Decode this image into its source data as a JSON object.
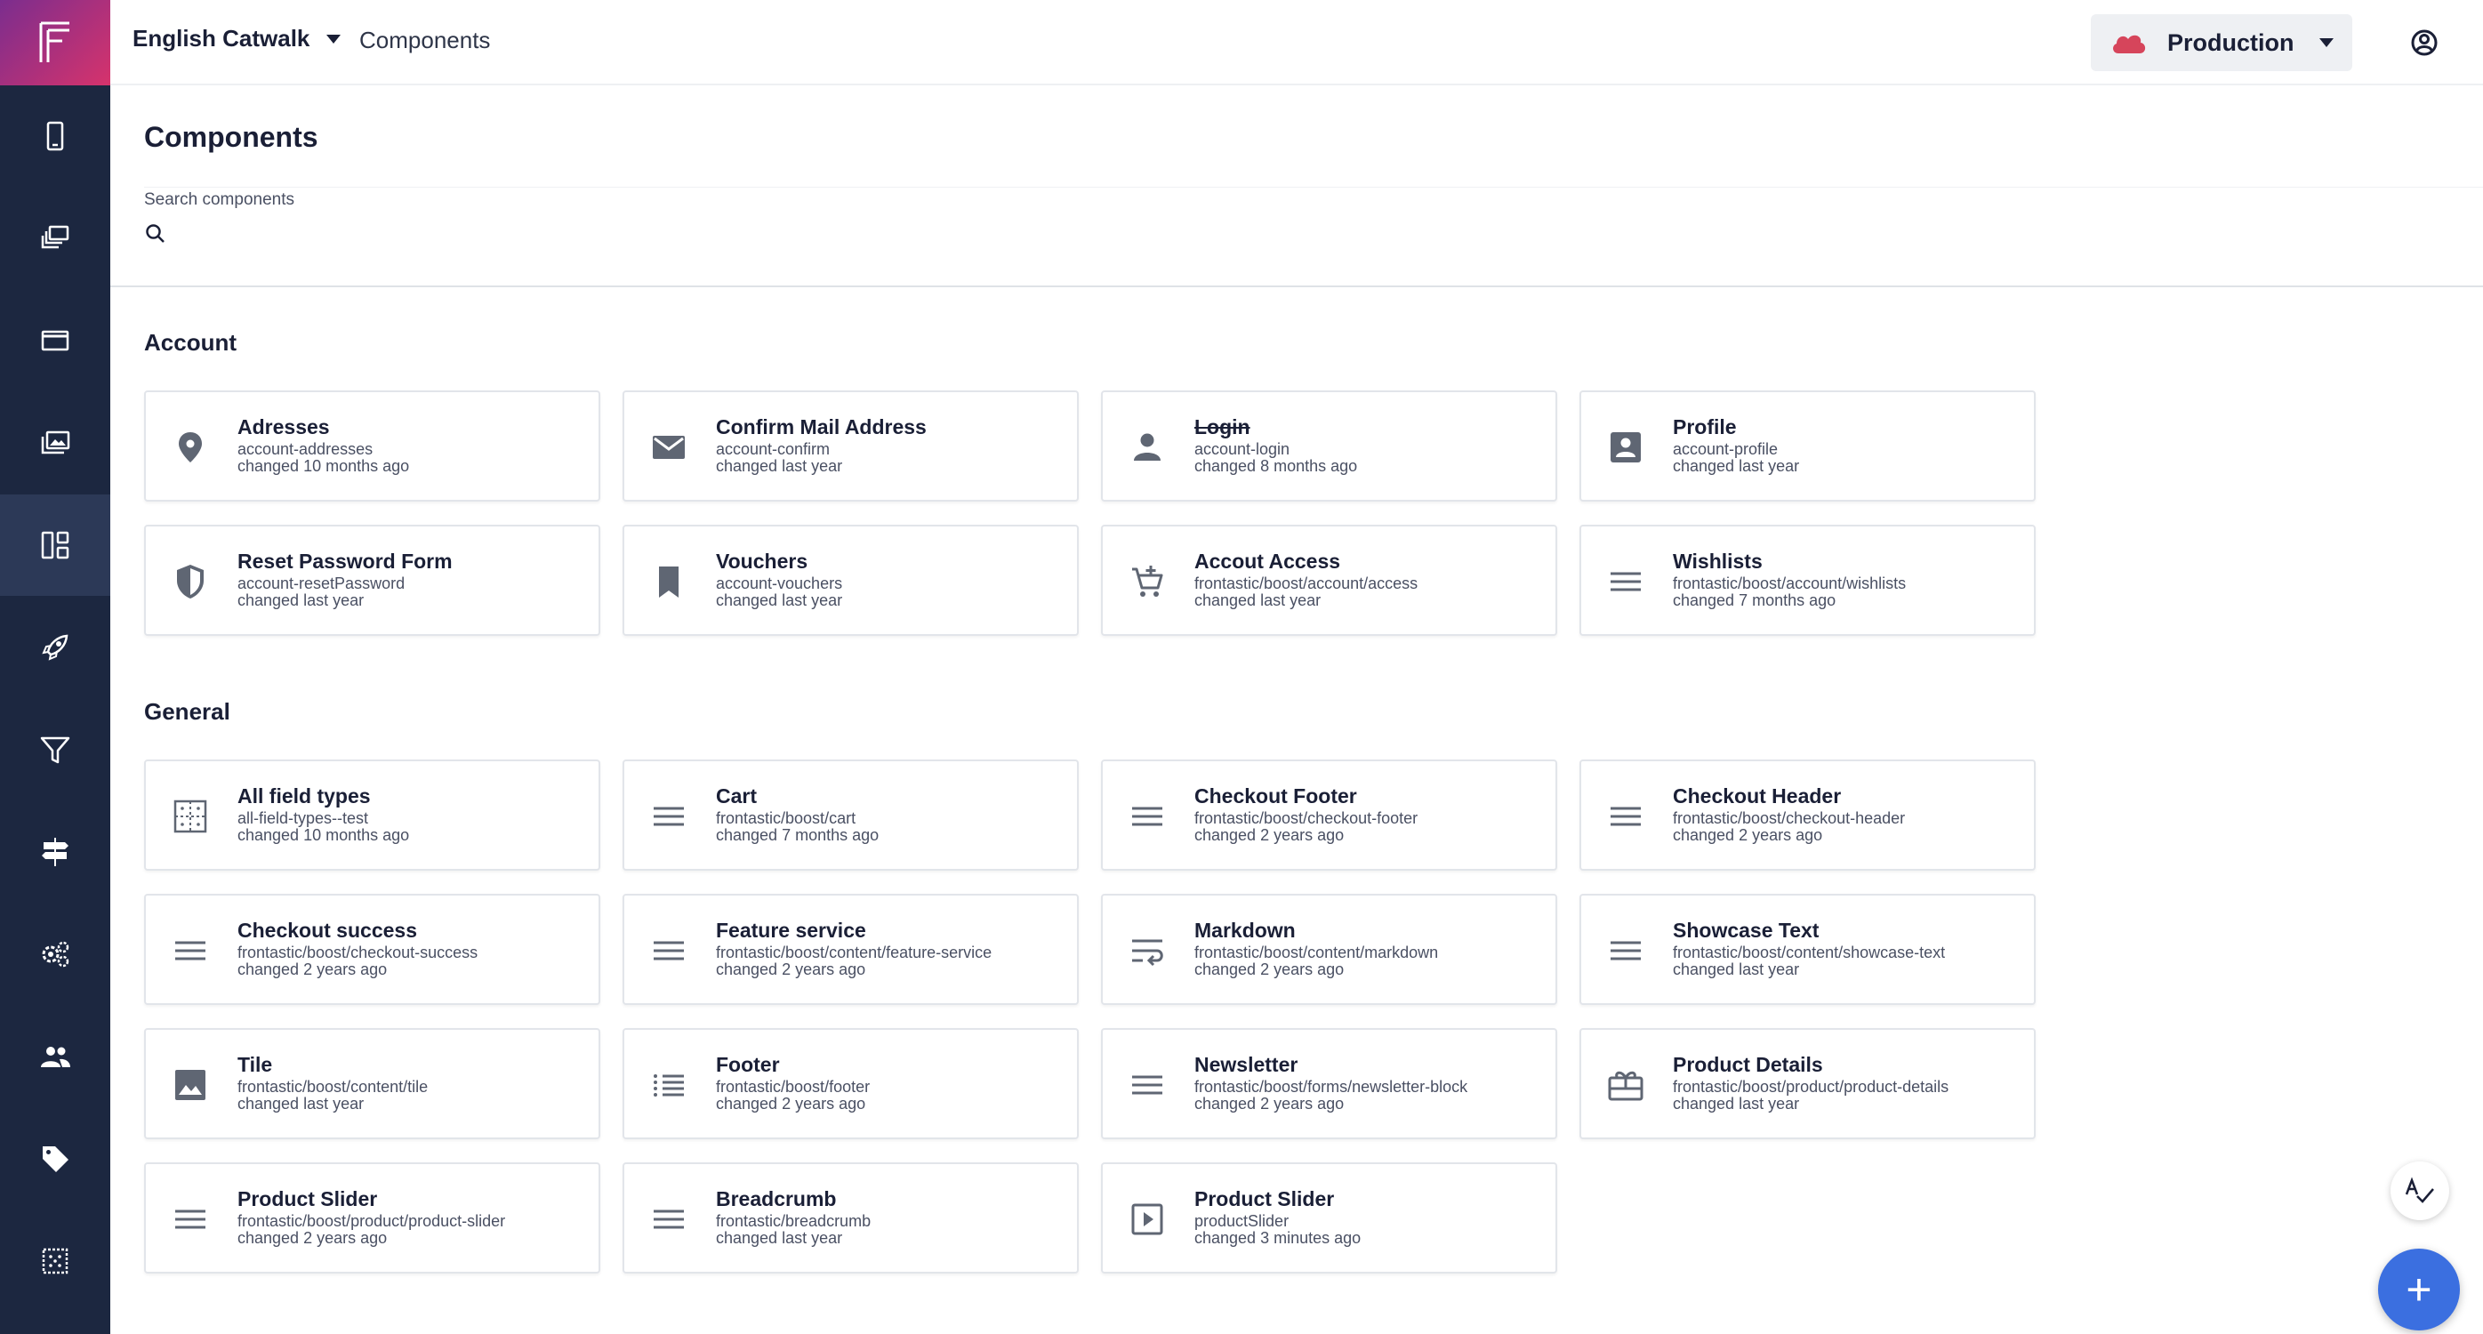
{
  "header": {
    "project_name": "English Catwalk",
    "breadcrumb": "Components",
    "environment": "Production"
  },
  "page": {
    "title": "Components",
    "search_label": "Search components",
    "search_value": ""
  },
  "sidebar": {
    "items": [
      {
        "icon": "mobile-icon"
      },
      {
        "icon": "pages-icon"
      },
      {
        "icon": "window-icon"
      },
      {
        "icon": "media-icon"
      },
      {
        "icon": "components-icon",
        "active": true
      },
      {
        "icon": "rocket-icon"
      },
      {
        "icon": "filter-icon"
      },
      {
        "icon": "signpost-icon"
      },
      {
        "icon": "settings-icon"
      },
      {
        "icon": "users-icon"
      },
      {
        "icon": "tag-icon"
      },
      {
        "icon": "grid-icon"
      }
    ]
  },
  "sections": [
    {
      "title": "Account",
      "cards": [
        {
          "name": "Adresses",
          "id": "account-addresses",
          "changed": "changed 10 months ago",
          "icon": "location-pin"
        },
        {
          "name": "Confirm Mail Address",
          "id": "account-confirm",
          "changed": "changed last year",
          "icon": "mail"
        },
        {
          "name": "Login",
          "id": "account-login",
          "changed": "changed 8 months ago",
          "icon": "person",
          "deprecated": true
        },
        {
          "name": "Profile",
          "id": "account-profile",
          "changed": "changed last year",
          "icon": "account-box"
        },
        {
          "name": "Reset Password Form",
          "id": "account-resetPassword",
          "changed": "changed last year",
          "icon": "shield"
        },
        {
          "name": "Vouchers",
          "id": "account-vouchers",
          "changed": "changed last year",
          "icon": "bookmark"
        },
        {
          "name": "Accout Access",
          "id": "frontastic/boost/account/access",
          "changed": "changed last year",
          "icon": "add-cart"
        },
        {
          "name": "Wishlists",
          "id": "frontastic/boost/account/wishlists",
          "changed": "changed 7 months ago",
          "icon": "lines"
        }
      ]
    },
    {
      "title": "General",
      "cards": [
        {
          "name": "All field types",
          "id": "all-field-types--test",
          "changed": "changed 10 months ago",
          "icon": "dotted-grid"
        },
        {
          "name": "Cart",
          "id": "frontastic/boost/cart",
          "changed": "changed 7 months ago",
          "icon": "lines"
        },
        {
          "name": "Checkout Footer",
          "id": "frontastic/boost/checkout-footer",
          "changed": "changed 2 years ago",
          "icon": "lines"
        },
        {
          "name": "Checkout Header",
          "id": "frontastic/boost/checkout-header",
          "changed": "changed 2 years ago",
          "icon": "lines"
        },
        {
          "name": "Checkout success",
          "id": "frontastic/boost/checkout-success",
          "changed": "changed 2 years ago",
          "icon": "lines"
        },
        {
          "name": "Feature service",
          "id": "frontastic/boost/content/feature-service",
          "changed": "changed 2 years ago",
          "icon": "lines"
        },
        {
          "name": "Markdown",
          "id": "frontastic/boost/content/markdown",
          "changed": "changed 2 years ago",
          "icon": "wrap-text"
        },
        {
          "name": "Showcase Text",
          "id": "frontastic/boost/content/showcase-text",
          "changed": "changed last year",
          "icon": "lines"
        },
        {
          "name": "Tile",
          "id": "frontastic/boost/content/tile",
          "changed": "changed last year",
          "icon": "image"
        },
        {
          "name": "Footer",
          "id": "frontastic/boost/footer",
          "changed": "changed 2 years ago",
          "icon": "list"
        },
        {
          "name": "Newsletter",
          "id": "frontastic/boost/forms/newsletter-block",
          "changed": "changed 2 years ago",
          "icon": "lines"
        },
        {
          "name": "Product Details",
          "id": "frontastic/boost/product/product-details",
          "changed": "changed last year",
          "icon": "gift"
        },
        {
          "name": "Product Slider",
          "id": "frontastic/boost/product/product-slider",
          "changed": "changed 2 years ago",
          "icon": "lines"
        },
        {
          "name": "Breadcrumb",
          "id": "frontastic/breadcrumb",
          "changed": "changed last year",
          "icon": "lines"
        },
        {
          "name": "Product Slider",
          "id": "productSlider",
          "changed": "changed 3 minutes ago",
          "icon": "play-box"
        }
      ]
    }
  ],
  "colors": {
    "sidebar": "#1c2740",
    "sidebar_active": "#2c3957",
    "brand_gradient_start": "#7b2d8e",
    "brand_gradient_end": "#d6336c",
    "environment_cloud": "#d6455b",
    "fab": "#3b6fe0",
    "icon": "#5f6673"
  },
  "fab": {
    "label": "+"
  }
}
